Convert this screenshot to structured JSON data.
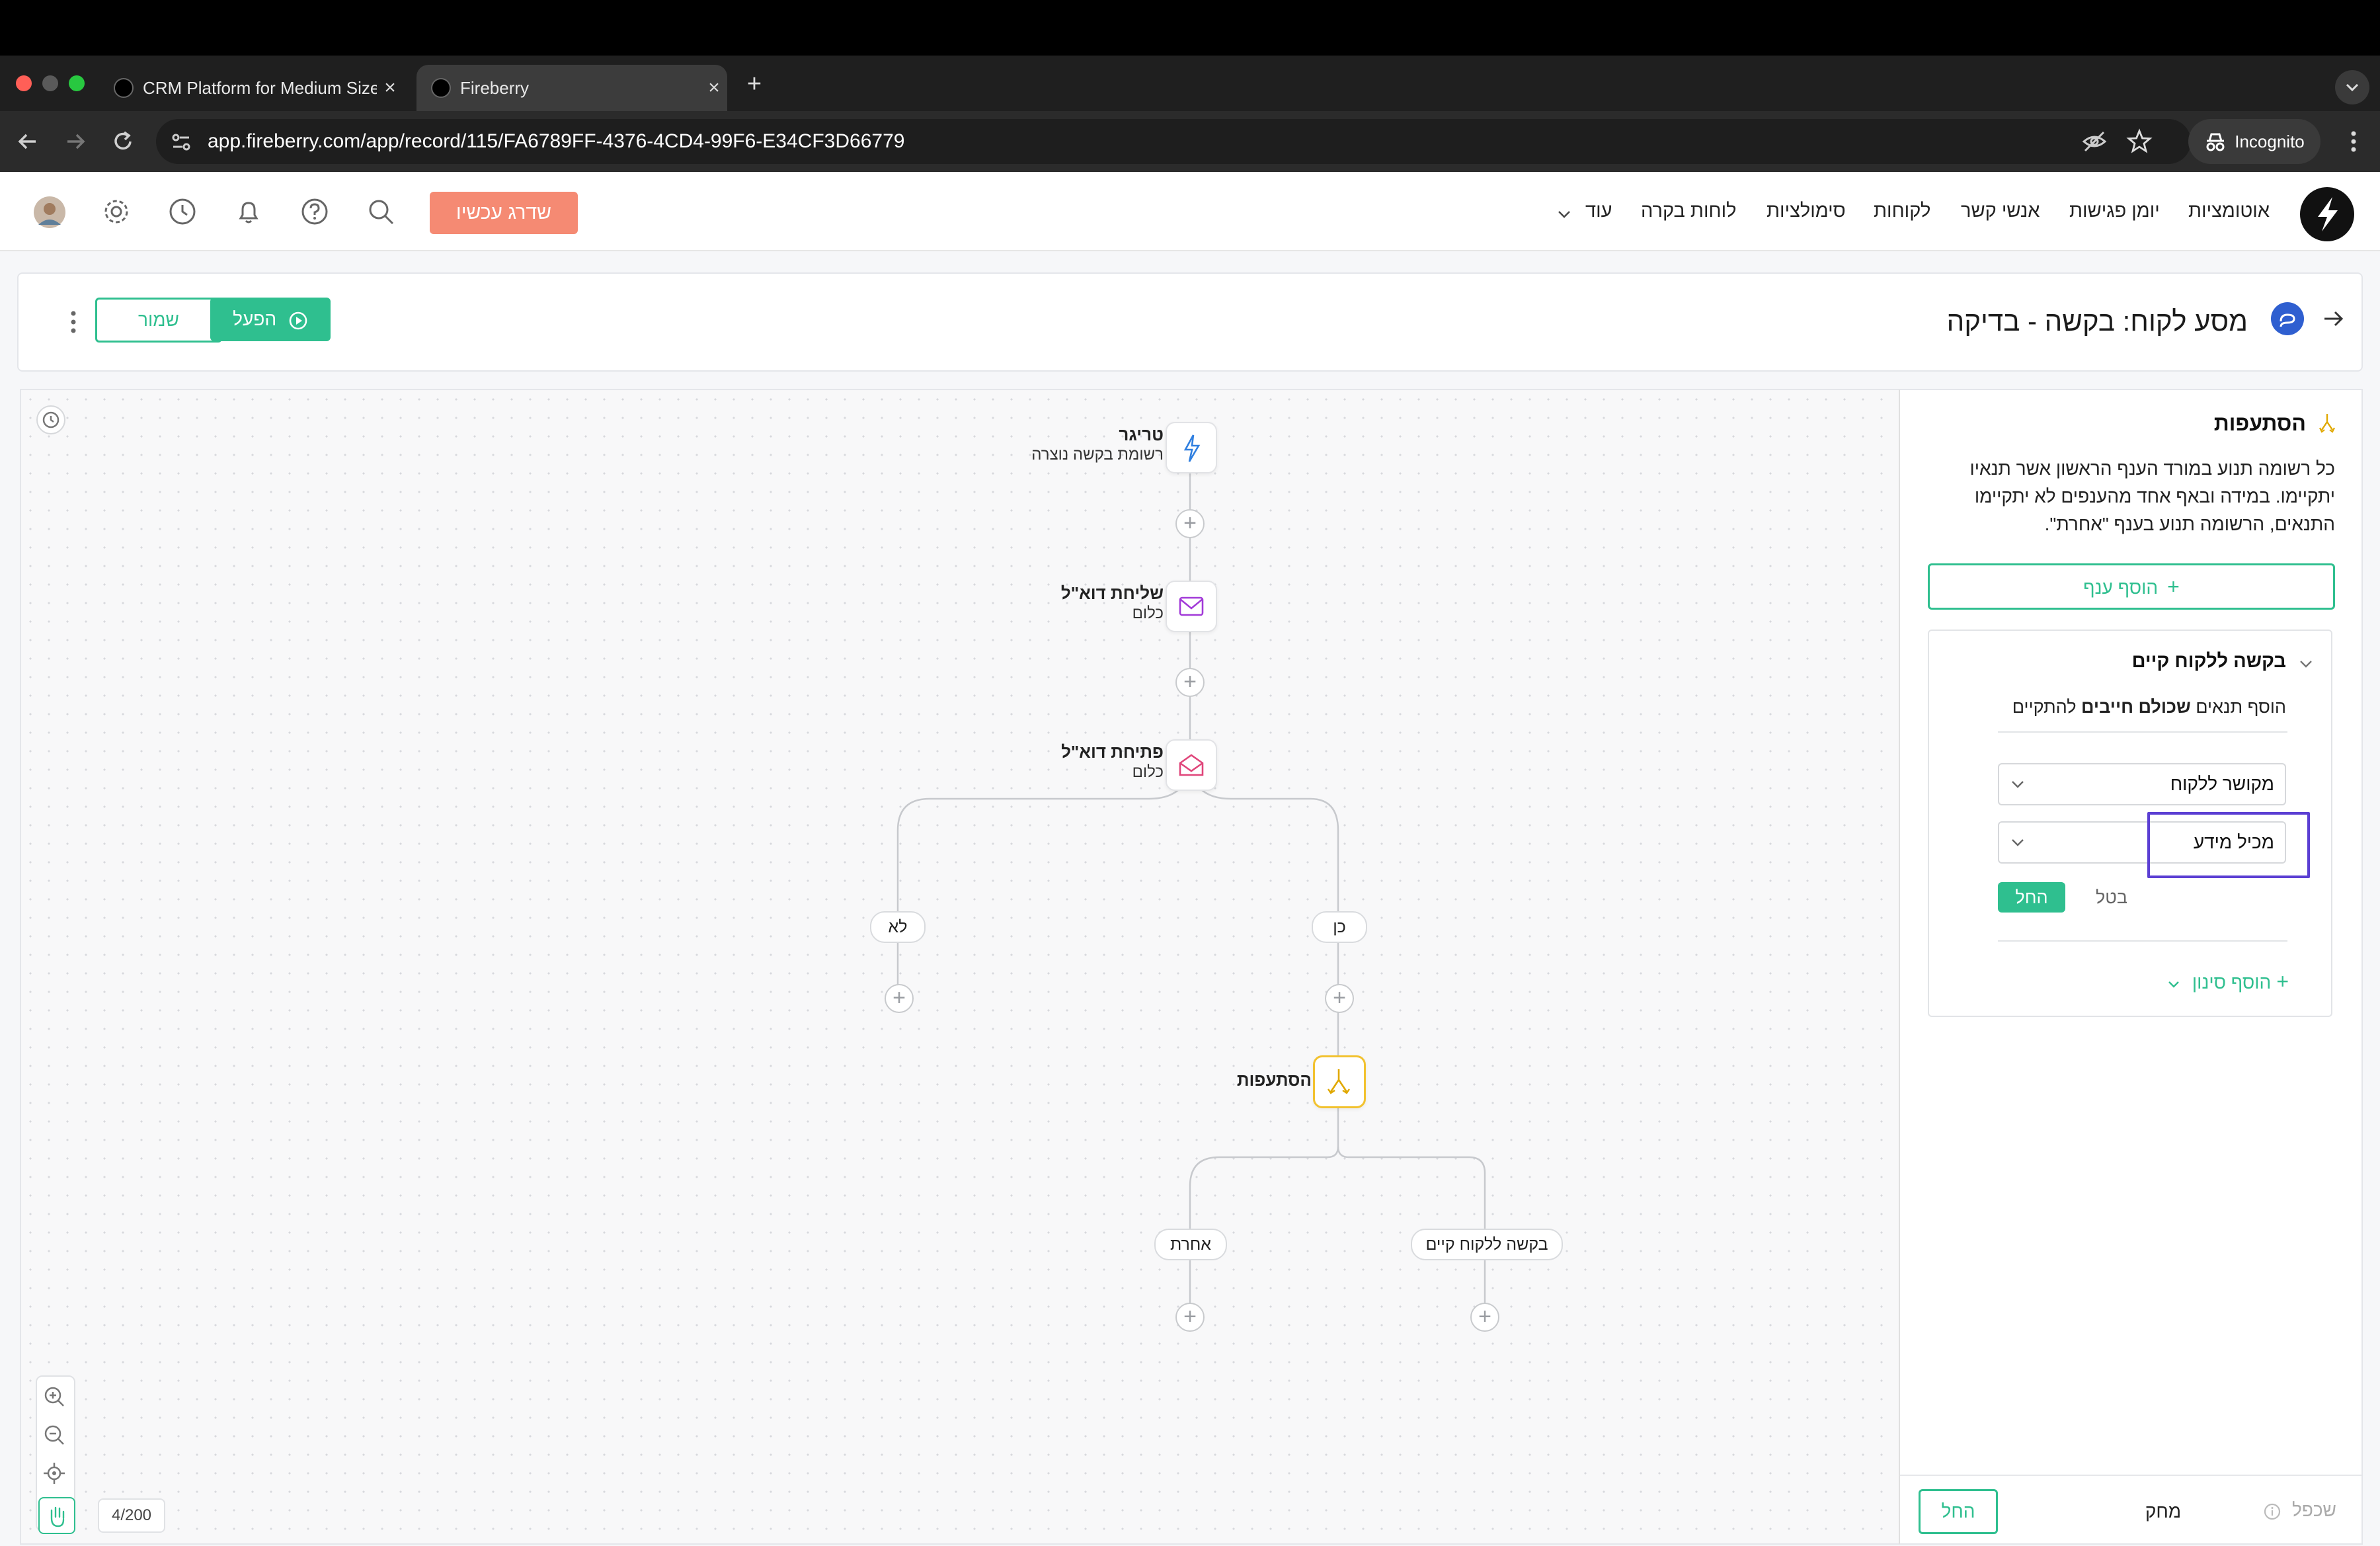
{
  "browser": {
    "tabs": [
      {
        "title": "CRM Platform for Medium Size"
      },
      {
        "title": "Fireberry"
      }
    ],
    "url": "app.fireberry.com/app/record/115/FA6789FF-4376-4CD4-99F6-E34CF3D66779",
    "incognito_label": "Incognito",
    "new_tab": "+",
    "close": "×"
  },
  "topnav": {
    "menu": [
      "אוטומציות",
      "יומן פגישות",
      "אנשי קשר",
      "לקוחות",
      "סימולציות",
      "לוחות בקרה",
      "עוד"
    ],
    "upgrade_label": "שדרג עכשיו"
  },
  "header": {
    "title": "מסע לקוח: בקשה - בדיקה",
    "activate_label": "הפעל",
    "save_label": "שמור"
  },
  "flow": {
    "trigger": {
      "title": "טריגר",
      "subtitle": "רשומת בקשה נוצרה"
    },
    "send_email": {
      "title": "שליחת דוא\"ל",
      "subtitle": "כלום"
    },
    "open_email": {
      "title": "פתיחת דוא\"ל",
      "subtitle": "כלום"
    },
    "branch_yes": "כן",
    "branch_no": "לא",
    "split": {
      "title": "הסתעפות"
    },
    "branch_existing": "בקשה ללקוח קיים",
    "branch_other": "אחרת",
    "counter": "4/200"
  },
  "panel": {
    "title": "הסתעפות",
    "description": "כל רשומה תנוע במורד הענף הראשון אשר תנאיו יתקיימו. במידה ובאף אחד מהענפים לא יתקיימו התנאים, הרשומה תנוע בענף \"אחרת\".",
    "add_branch": "הוסף ענף",
    "branch": {
      "name": "בקשה ללקוח קיים",
      "condition_prefix": "הוסף תנאים",
      "condition_bold": "שכולם חייבים",
      "condition_suffix": "להתקיים",
      "field_select": "מקושר ללקוח",
      "operator_select": "מכיל מידע",
      "apply": "החל",
      "cancel": "בטל",
      "add_filter": "הוסף סינון"
    },
    "footer": {
      "apply": "החל",
      "delete": "מחק",
      "duplicate": "שכפל"
    }
  },
  "colors": {
    "accent_green": "#2fbf8f",
    "upgrade_orange": "#f58a73",
    "highlight_purple": "#5b3fd3",
    "split_yellow": "#f2c230"
  }
}
